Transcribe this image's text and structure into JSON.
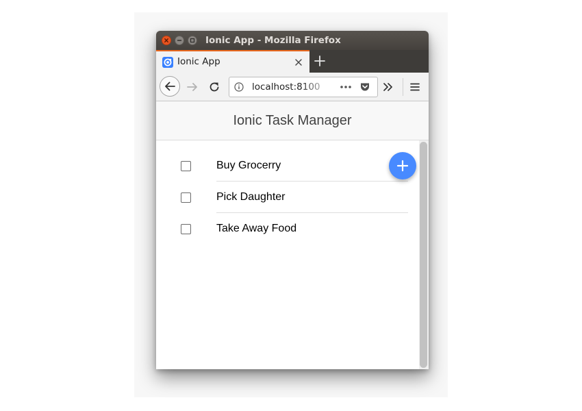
{
  "window": {
    "title": "Ionic App - Mozilla Firefox"
  },
  "tab": {
    "label": "Ionic App",
    "favicon": "ionic-logo-icon"
  },
  "navbar": {
    "url": "localhost:8100",
    "icons": [
      "back-arrow-icon",
      "forward-arrow-icon",
      "reload-icon",
      "info-icon",
      "more-dots-icon",
      "pocket-icon",
      "overflow-chevrons-icon",
      "hamburger-menu-icon"
    ]
  },
  "app": {
    "title": "Ionic Task Manager",
    "tasks": [
      {
        "label": "Buy Grocerry",
        "checked": false
      },
      {
        "label": "Pick Daughter",
        "checked": false
      },
      {
        "label": "Take Away Food",
        "checked": false
      }
    ],
    "fab_icon": "plus-icon"
  },
  "colors": {
    "titlebar": "#4a4643",
    "tab_accent": "#e9681d",
    "close_button": "#e95420",
    "fab": "#488aff",
    "favicon": "#3880ff"
  }
}
